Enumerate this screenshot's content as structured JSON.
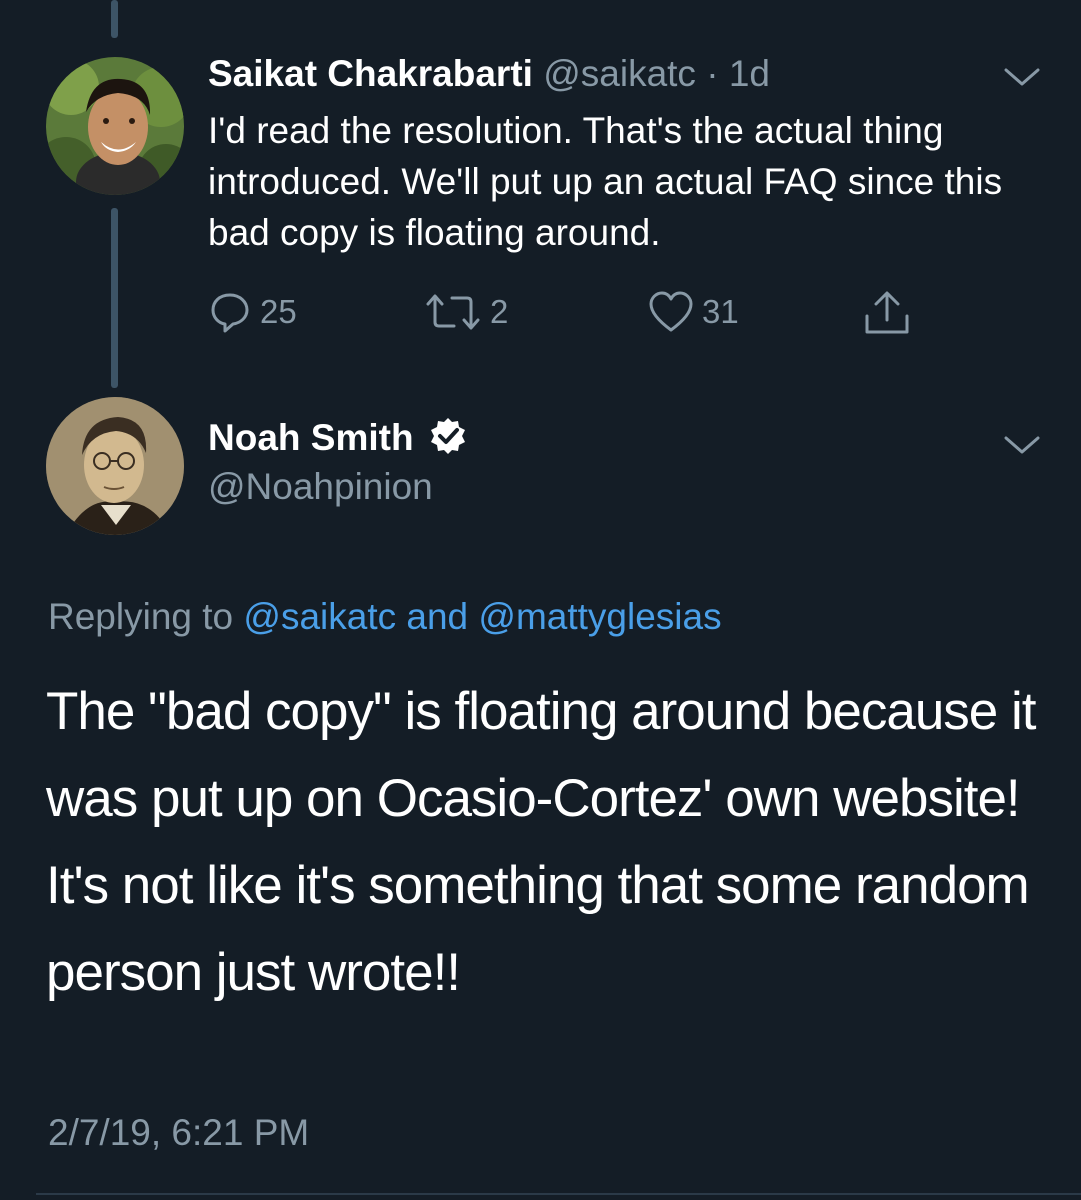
{
  "tweet1": {
    "display_name": "Saikat Chakrabarti",
    "handle": "@saikatc",
    "separator": "·",
    "time_ago": "1d",
    "text": "I'd read the resolution. That's the actual thing introduced. We'll put up an actual FAQ since this bad copy is floating around.",
    "reply_count": "25",
    "retweet_count": "2",
    "like_count": "31",
    "icons": {
      "reply": "reply-icon",
      "retweet": "retweet-icon",
      "like": "heart-icon",
      "share": "share-icon",
      "menu": "chevron-down-icon"
    }
  },
  "tweet2": {
    "display_name": "Noah Smith",
    "handle": "@Noahpinion",
    "verified": true,
    "replying_prefix": "Replying to",
    "reply_handle_1": "@saikatc",
    "reply_joiner": "and",
    "reply_handle_2": "@mattyglesias",
    "text": "The \"bad copy\" is floating around because it was put up on Ocasio-Cortez' own website! It's not like it's something that some random person just wrote!!",
    "timestamp": "2/7/19, 6:21 PM"
  },
  "colors": {
    "background": "#141d26",
    "text": "#ffffff",
    "muted": "#8899a6",
    "link": "#4a9fe8",
    "thread_line": "#3d5466"
  }
}
